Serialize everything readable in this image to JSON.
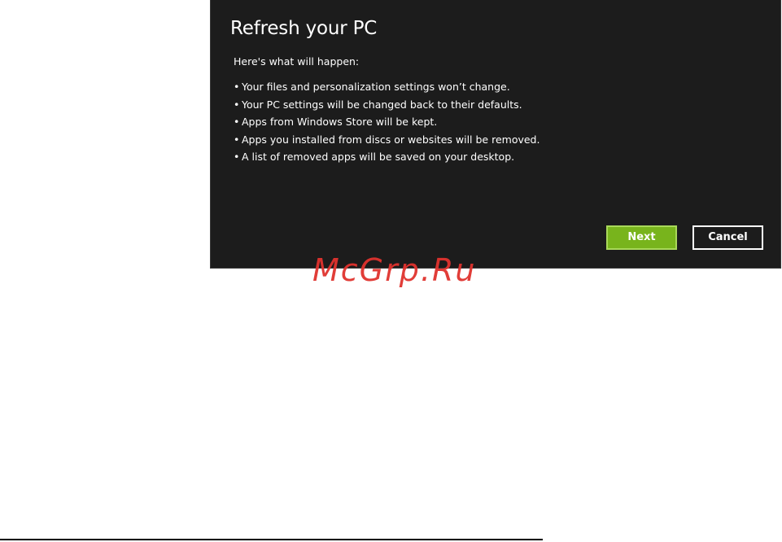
{
  "dialog": {
    "title": "Refresh your PC",
    "intro": "Here's what will happen:",
    "bullet_char": "•",
    "bullets": [
      "Your files and personalization settings won’t change.",
      "Your PC settings will be changed back to their defaults.",
      "Apps from Windows Store will be kept.",
      "Apps you installed from discs or websites will be removed.",
      "A list of removed apps will be saved on your desktop."
    ],
    "next_label": "Next",
    "cancel_label": "Cancel"
  },
  "watermark": "McGrp.Ru",
  "colors": {
    "dialog_bg": "#1c1c1c",
    "accent_green": "#78b41c",
    "text": "#ffffff",
    "watermark": "#e0332e"
  }
}
